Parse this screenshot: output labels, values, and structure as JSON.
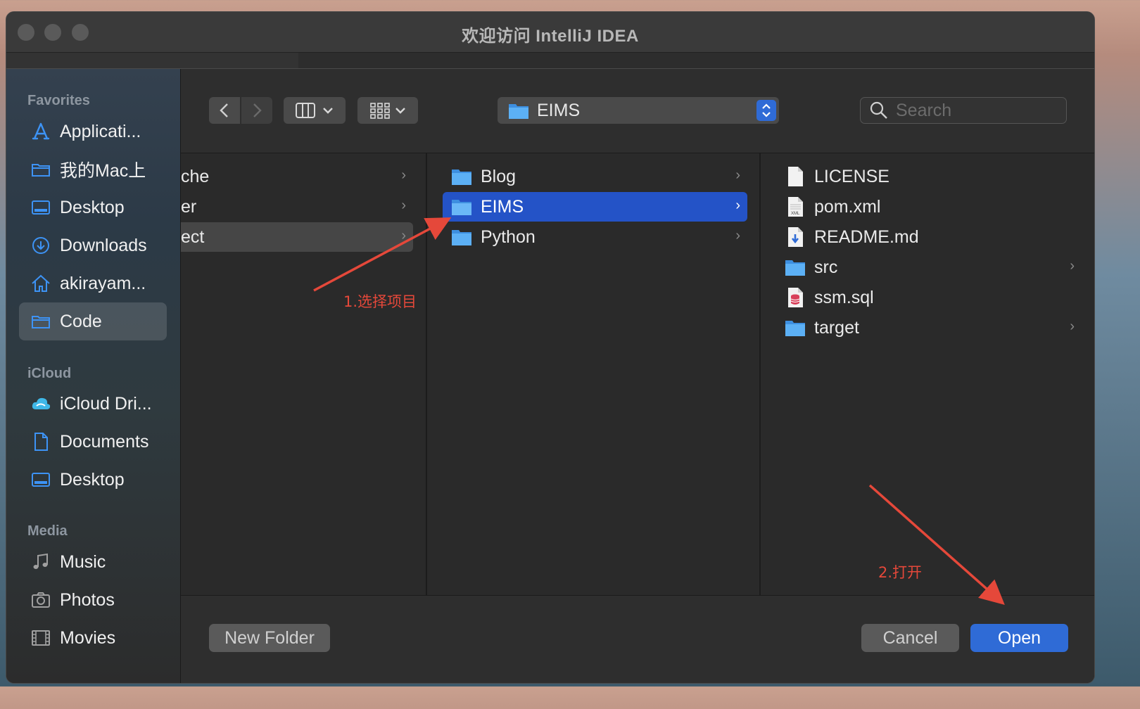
{
  "window": {
    "title": "欢迎访问 IntelliJ IDEA"
  },
  "sidebar": {
    "sections": [
      {
        "label": "Favorites",
        "items": [
          {
            "label": "Applicati...",
            "icon": "applications-icon"
          },
          {
            "label": "我的Mac上",
            "icon": "folder-icon"
          },
          {
            "label": "Desktop",
            "icon": "desktop-icon"
          },
          {
            "label": "Downloads",
            "icon": "downloads-icon"
          },
          {
            "label": "akirayam...",
            "icon": "home-icon"
          },
          {
            "label": "Code",
            "icon": "folder-icon",
            "selected": true
          }
        ]
      },
      {
        "label": "iCloud",
        "items": [
          {
            "label": "iCloud Dri...",
            "icon": "icloud-icon"
          },
          {
            "label": "Documents",
            "icon": "document-icon"
          },
          {
            "label": "Desktop",
            "icon": "desktop-icon"
          }
        ]
      },
      {
        "label": "Media",
        "items": [
          {
            "label": "Music",
            "icon": "music-icon"
          },
          {
            "label": "Photos",
            "icon": "camera-icon"
          },
          {
            "label": "Movies",
            "icon": "film-icon"
          }
        ]
      }
    ]
  },
  "toolbar": {
    "path": "EIMS",
    "search_placeholder": "Search"
  },
  "columns": {
    "col1": [
      {
        "label": "che",
        "chevron": "›"
      },
      {
        "label": "er",
        "chevron": "›"
      },
      {
        "label": "ect",
        "chevron": "›",
        "selected": true
      }
    ],
    "col2": [
      {
        "label": "Blog",
        "chevron": "›"
      },
      {
        "label": "EIMS",
        "chevron": "›",
        "selected": true
      },
      {
        "label": "Python",
        "chevron": "›"
      }
    ],
    "col3": [
      {
        "label": "LICENSE",
        "icon": "file-icon"
      },
      {
        "label": "pom.xml",
        "icon": "xml-file-icon"
      },
      {
        "label": "README.md",
        "icon": "markdown-file-icon"
      },
      {
        "label": "src",
        "icon": "folder-icon",
        "chevron": "›"
      },
      {
        "label": "ssm.sql",
        "icon": "sql-file-icon"
      },
      {
        "label": "target",
        "icon": "folder-icon",
        "chevron": "›"
      }
    ]
  },
  "footer": {
    "new_folder": "New Folder",
    "cancel": "Cancel",
    "open": "Open"
  },
  "annotations": {
    "step1": "1.选择项目",
    "step2": "2.打开",
    "color": "#e5483a"
  },
  "colors": {
    "accent": "#2f6bd6",
    "selection_blue": "#2453c7",
    "folder_blue": "#4aa3f0"
  }
}
